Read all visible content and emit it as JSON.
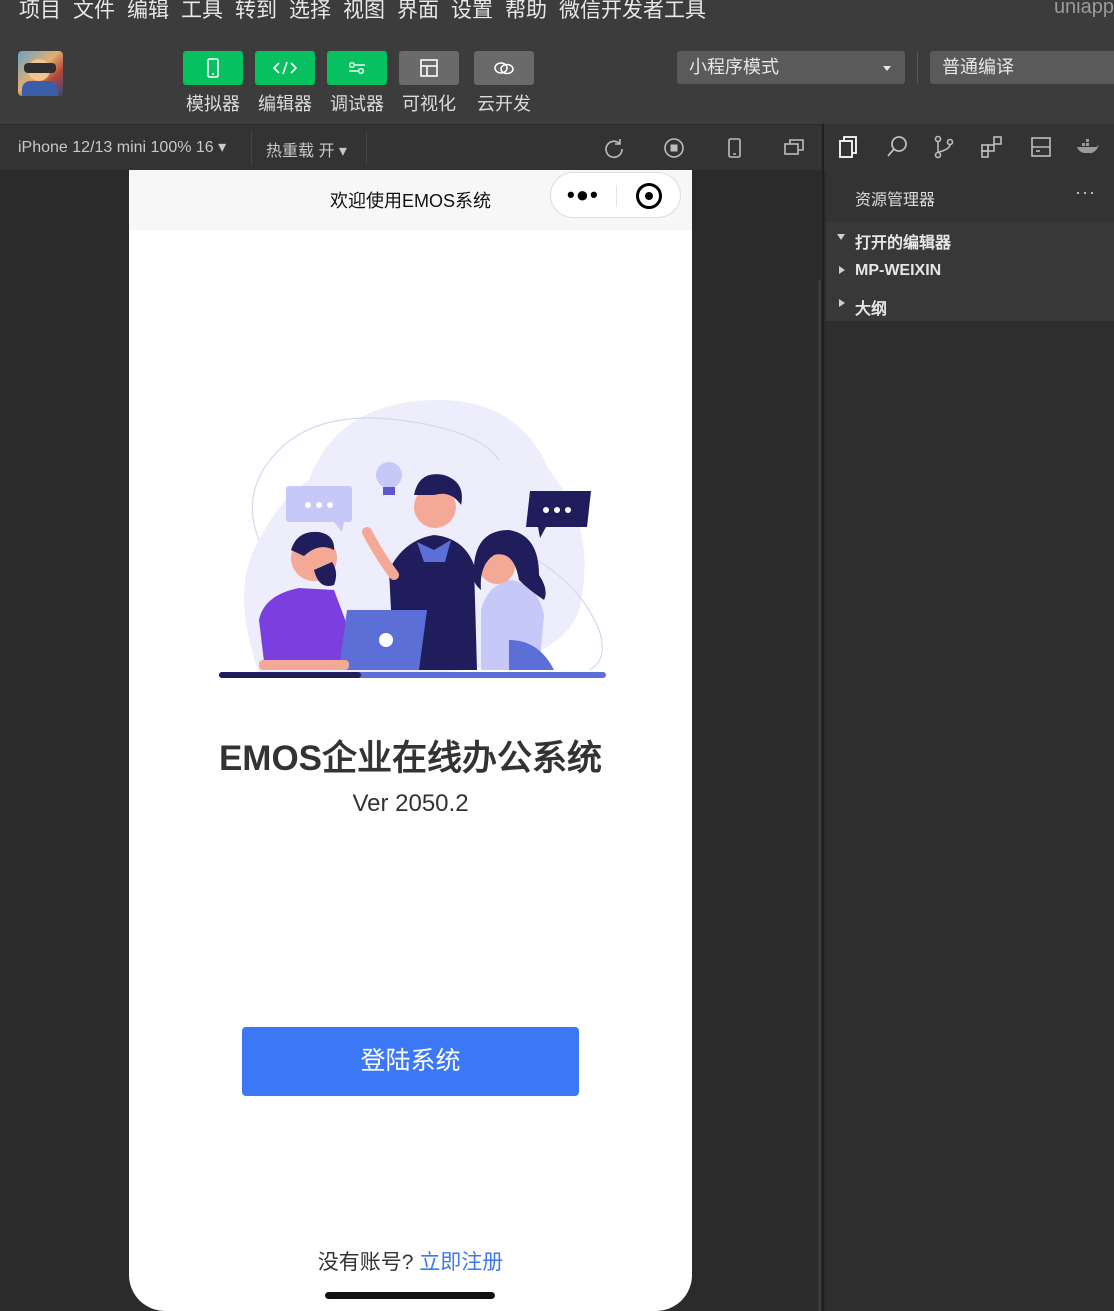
{
  "menubar": {
    "items": [
      "项目",
      "文件",
      "编辑",
      "工具",
      "转到",
      "选择",
      "视图",
      "界面",
      "设置",
      "帮助",
      "微信开发者工具"
    ],
    "right_text": "uniapp"
  },
  "toolbar": {
    "buttons": [
      {
        "label": "模拟器",
        "icon": "phone-icon",
        "color": "#07c160"
      },
      {
        "label": "编辑器",
        "icon": "code-icon",
        "color": "#07c160"
      },
      {
        "label": "调试器",
        "icon": "debug-sliders-icon",
        "color": "#07c160"
      },
      {
        "label": "可视化",
        "icon": "layout-icon",
        "color": "#6a6a6a"
      },
      {
        "label": "云开发",
        "icon": "cloud-icon",
        "color": "#6a6a6a"
      }
    ],
    "mode_select": "小程序模式",
    "compile_select": "普通编译"
  },
  "subbar": {
    "device": "iPhone 12/13 mini 100% 16 ▾",
    "hot_reload": "热重载 开 ▾"
  },
  "explorer": {
    "title": "资源管理器",
    "more": "···",
    "sections": [
      "打开的编辑器",
      "MP-WEIXIN",
      "大纲"
    ]
  },
  "phone": {
    "nav_title": "欢迎使用EMOS系统",
    "app_title": "EMOS企业在线办公系统",
    "version": "Ver 2050.2",
    "login_button": "登陆系统",
    "footer_text": "没有账号?",
    "register_link": "立即注册"
  },
  "colors": {
    "accent_green": "#07c160",
    "login_blue": "#3c78f6",
    "link_blue": "#3b78f2"
  }
}
